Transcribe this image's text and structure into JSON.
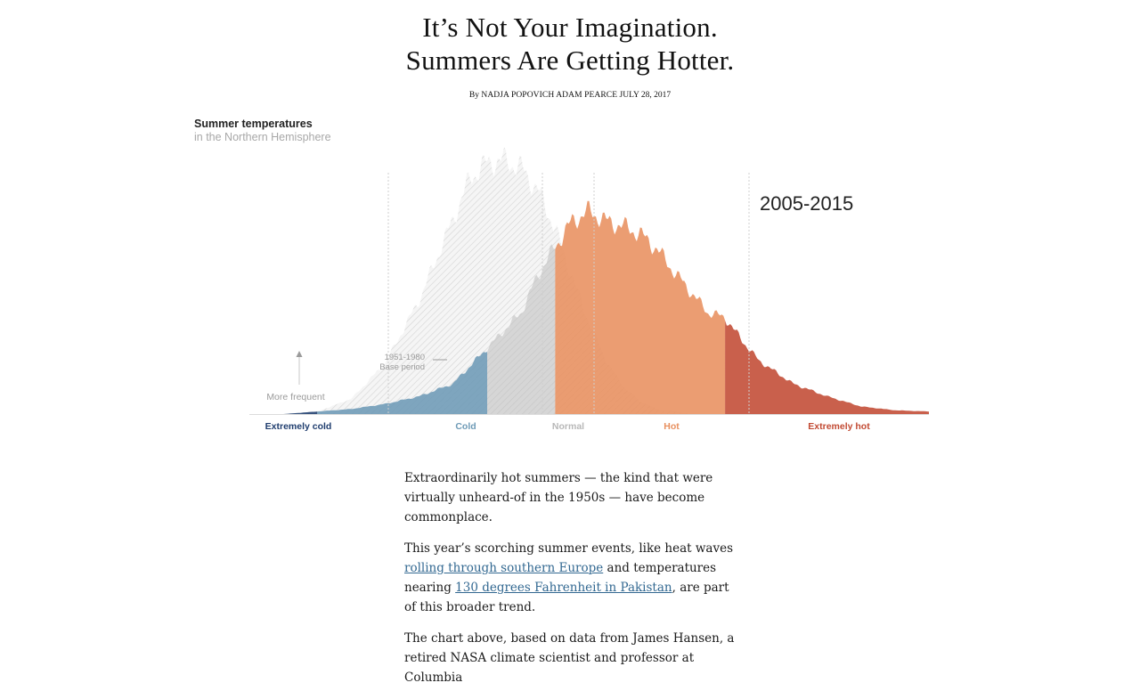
{
  "article": {
    "headline_line1": "It’s Not Your Imagination.",
    "headline_line2": "Summers Are Getting Hotter.",
    "byline_prefix": "By",
    "byline_authors": "Nadja Popovich Adam Pearce",
    "byline_date": "JULY 28, 2017",
    "p1": "Extraordinarily hot summers — the kind that were virtually unheard-of in the 1950s — have become commonplace.",
    "p2_before": "This year’s scorching summer events, like heat waves ",
    "p2_link1": "rolling through southern Europe",
    "p2_mid": " and temperatures nearing ",
    "p2_link2": "130 degrees Fahrenheit in Pakistan",
    "p2_after": ", are part of this broader trend.",
    "p3": "The chart above, based on data from James Hansen, a retired NASA climate scientist and professor at Columbia"
  },
  "chart": {
    "title": "Summer temperatures",
    "subtitle": "in the Northern Hemisphere",
    "period_label": "2005-2015",
    "base_period_line1": "1951-1980",
    "base_period_line2": "Base period",
    "frequency_label": "More frequent"
  },
  "chart_data": {
    "type": "area",
    "x_unit": "standard deviations from 1951-1980 mean",
    "categories": [
      {
        "label": "Extremely cold",
        "range": [
          -4,
          -3
        ],
        "color": "#1f3d6e"
      },
      {
        "label": "Cold",
        "range": [
          -3,
          -0.5
        ],
        "color": "#6d9ab6"
      },
      {
        "label": "Normal",
        "range": [
          -0.5,
          0.5
        ],
        "color": "#b8b8b8"
      },
      {
        "label": "Hot",
        "range": [
          0.5,
          3
        ],
        "color": "#e8905f"
      },
      {
        "label": "Extremely hot",
        "range": [
          3,
          6
        ],
        "color": "#c24a33"
      }
    ],
    "series": [
      {
        "name": "1951-1980",
        "style": "hatched-gray"
      },
      {
        "name": "2005-2015",
        "style": "colored-by-category"
      }
    ],
    "x": [
      -4,
      -3.5,
      -3,
      -2.5,
      -2,
      -1.5,
      -1,
      -0.75,
      -0.5,
      -0.25,
      0,
      0.25,
      0.5,
      0.75,
      1,
      1.25,
      1.5,
      1.75,
      2,
      2.25,
      2.5,
      2.75,
      3,
      3.25,
      3.5,
      4,
      4.5,
      5,
      5.5,
      6
    ],
    "values_base": [
      0,
      0,
      0.01,
      0.06,
      0.2,
      0.45,
      0.77,
      0.93,
      0.99,
      1.0,
      0.97,
      0.88,
      0.73,
      0.54,
      0.36,
      0.21,
      0.11,
      0.05,
      0.02,
      0.01,
      0,
      0,
      0,
      0,
      0,
      0,
      0,
      0,
      0,
      0
    ],
    "values_recent": [
      0,
      0,
      0.01,
      0.02,
      0.04,
      0.07,
      0.12,
      0.19,
      0.26,
      0.33,
      0.4,
      0.55,
      0.66,
      0.76,
      0.8,
      0.76,
      0.74,
      0.71,
      0.65,
      0.56,
      0.48,
      0.4,
      0.38,
      0.29,
      0.21,
      0.12,
      0.07,
      0.03,
      0.015,
      0.01
    ],
    "xlim": [
      -4,
      6
    ]
  }
}
